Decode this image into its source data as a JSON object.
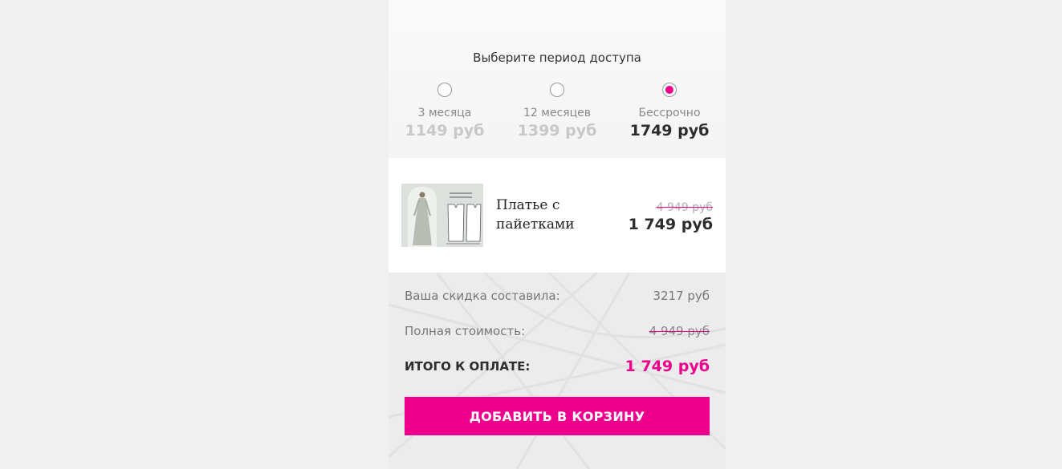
{
  "period": {
    "title": "Выберите период доступа",
    "options": [
      {
        "label": "3 месяца",
        "price": "1149 руб",
        "selected": false
      },
      {
        "label": "12 месяцев",
        "price": "1399 руб",
        "selected": false
      },
      {
        "label": "Бессрочно",
        "price": "1749 руб",
        "selected": true
      }
    ]
  },
  "product": {
    "name": "Платье с пайетками",
    "old_price": "4 949 руб",
    "price": "1 749 руб"
  },
  "summary": {
    "discount_label": "Ваша скидка составила:",
    "discount_value": "3217 руб",
    "full_label": "Полная стоимость:",
    "full_value": "4 949 руб",
    "total_label": "ИТОГО К ОПЛАТЕ:",
    "total_value": "1 749 руб"
  },
  "button": {
    "label": "ДОБАВИТЬ В КОРЗИНУ"
  },
  "colors": {
    "accent": "#ec008c",
    "dark_text": "#2d2d2d",
    "muted_text": "#888888"
  }
}
